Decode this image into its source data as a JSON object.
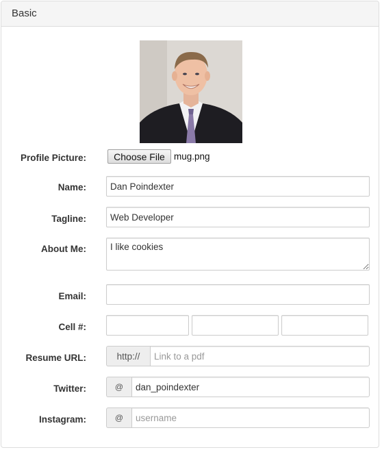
{
  "panel": {
    "title": "Basic"
  },
  "labels": {
    "profile_picture": "Profile Picture:",
    "name": "Name:",
    "tagline": "Tagline:",
    "about_me": "About Me:",
    "email": "Email:",
    "cell": "Cell #:",
    "resume_url": "Resume URL:",
    "twitter": "Twitter:",
    "instagram": "Instagram:"
  },
  "profile_picture": {
    "button_label": "Choose File",
    "file_name": "mug.png"
  },
  "fields": {
    "name": "Dan Poindexter",
    "tagline": "Web Developer",
    "about_me": "I like cookies",
    "email": "",
    "cell_1": "",
    "cell_2": "",
    "cell_3": "",
    "resume_prefix": "http://",
    "resume_url": "",
    "resume_placeholder": "Link to a pdf",
    "twitter_prefix": "@",
    "twitter": "dan_poindexter",
    "instagram_prefix": "@",
    "instagram": "",
    "instagram_placeholder": "username"
  }
}
